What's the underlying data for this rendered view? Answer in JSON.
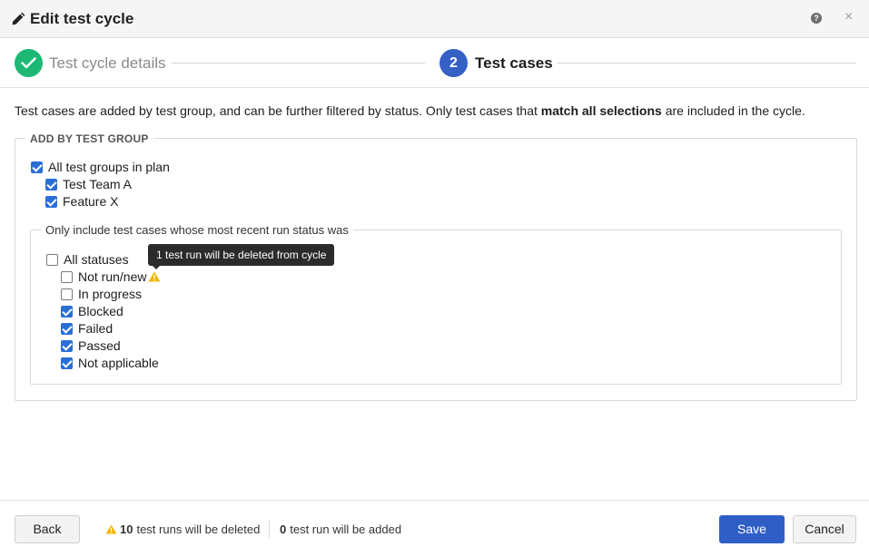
{
  "header": {
    "title": "Edit test cycle",
    "help_glyph": "?",
    "close_glyph": "×"
  },
  "stepper": {
    "step1": {
      "label": "Test cycle details",
      "state": "complete"
    },
    "step2": {
      "number": "2",
      "label": "Test cases",
      "state": "active"
    }
  },
  "intro": {
    "before": "Test cases are added by test group, and can be further filtered by status. Only test cases that ",
    "bold": "match all selections",
    "after": " are included in the cycle."
  },
  "groups": {
    "legend": "ADD BY TEST GROUP",
    "all": {
      "label": "All test groups in plan",
      "checked": true
    },
    "items": [
      {
        "label": "Test Team A",
        "checked": true
      },
      {
        "label": "Feature X",
        "checked": true
      }
    ]
  },
  "statuses": {
    "legend": "Only include test cases whose most recent run status was",
    "all": {
      "label": "All statuses",
      "checked": false
    },
    "items": [
      {
        "label": "Not run/new",
        "checked": false,
        "warning": true
      },
      {
        "label": "In progress",
        "checked": false
      },
      {
        "label": "Blocked",
        "checked": true
      },
      {
        "label": "Failed",
        "checked": true
      },
      {
        "label": "Passed",
        "checked": true
      },
      {
        "label": "Not applicable",
        "checked": true
      }
    ]
  },
  "tooltip": {
    "text": "1 test run will be deleted from cycle"
  },
  "footer": {
    "back_label": "Back",
    "deleted_count": "10",
    "deleted_text": "test runs will be deleted",
    "added_count": "0",
    "added_text": "test run will be added",
    "save_label": "Save",
    "cancel_label": "Cancel"
  },
  "colors": {
    "accent": "#2f5fc6",
    "success": "#1db974",
    "checkbox": "#2a6fd6",
    "warning": "#f2b705"
  },
  "icons": [
    "pencil-icon",
    "help-icon",
    "close-icon",
    "check-icon",
    "warning-icon"
  ]
}
